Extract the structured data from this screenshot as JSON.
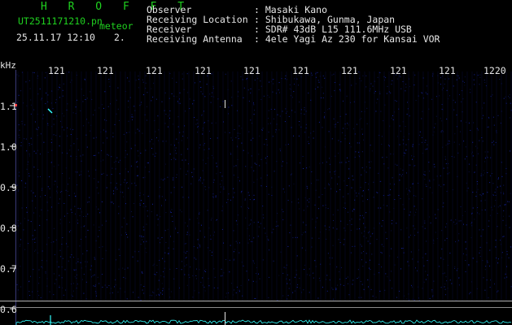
{
  "header": {
    "brand": "H R O F F T",
    "file_name": "UT2511171210.pn",
    "file_tag": "meteor",
    "datetime": "25.11.17 12:10",
    "frame": "2."
  },
  "station": {
    "observer_label": "Observer",
    "observer_value": ": Masaki Kano",
    "location_label": "Receiving Location",
    "location_value": ": Shibukawa, Gunma, Japan",
    "receiver_label": "Receiver",
    "receiver_value": ": SDR# 43dB L15 111.6MHz USB",
    "antenna_label": "Receiving Antenna",
    "antenna_value": ": 4ele Yagi Az 230 for Kansai VOR"
  },
  "axes": {
    "y_unit": "kHz",
    "x_ticks": [
      "121",
      "121",
      "121",
      "121",
      "121",
      "121",
      "121",
      "121",
      "121",
      "1220"
    ],
    "y_ticks": [
      "1.1",
      "1.0",
      "0.9",
      "0.8",
      "0.7",
      "0.6"
    ]
  },
  "colors": {
    "background": "#000000",
    "header_green": "#1fd11f",
    "text_white": "#e6e6e6",
    "noise_blue": "#1a2cc8",
    "signal_cyan": "#33ffff"
  }
}
